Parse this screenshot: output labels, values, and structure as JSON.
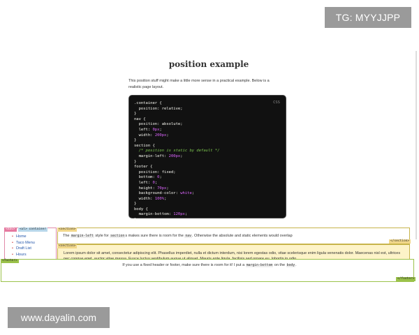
{
  "watermarks": {
    "top": "TG: MYYJJPP",
    "bottom": "www.dayalin.com"
  },
  "article": {
    "title": "position example",
    "intro": "This position stuff might make a little more sense in a practical example. Below is a realistic page layout."
  },
  "code_block": {
    "language_label": "CSS",
    "lines": [
      [
        {
          "t": ".container {"
        }
      ],
      [
        {
          "t": "  position: relative;"
        }
      ],
      [
        {
          "t": "}"
        }
      ],
      [
        {
          "t": "nav {"
        }
      ],
      [
        {
          "t": "  position: absolute;"
        }
      ],
      [
        {
          "t": "  left: "
        },
        {
          "t": "0px",
          "k": "v"
        },
        {
          "t": ";"
        }
      ],
      [
        {
          "t": "  width: "
        },
        {
          "t": "200px",
          "k": "v"
        },
        {
          "t": ";"
        }
      ],
      [
        {
          "t": "}"
        }
      ],
      [
        {
          "t": "section {"
        }
      ],
      [
        {
          "t": "  /* position is static by default */",
          "k": "c"
        }
      ],
      [
        {
          "t": "  margin-left: "
        },
        {
          "t": "200px",
          "k": "v"
        },
        {
          "t": ";"
        }
      ],
      [
        {
          "t": "}"
        }
      ],
      [
        {
          "t": "footer {"
        }
      ],
      [
        {
          "t": "  position: fixed;"
        }
      ],
      [
        {
          "t": "  bottom: "
        },
        {
          "t": "0",
          "k": "v"
        },
        {
          "t": ";"
        }
      ],
      [
        {
          "t": "  left: "
        },
        {
          "t": "0",
          "k": "v"
        },
        {
          "t": ";"
        }
      ],
      [
        {
          "t": "  height: "
        },
        {
          "t": "70px",
          "k": "v"
        },
        {
          "t": ";"
        }
      ],
      [
        {
          "t": "  background-color: "
        },
        {
          "t": "white",
          "k": "v"
        },
        {
          "t": ";"
        }
      ],
      [
        {
          "t": "  width: "
        },
        {
          "t": "100%",
          "k": "v"
        },
        {
          "t": ";"
        }
      ],
      [
        {
          "t": "}"
        }
      ],
      [
        {
          "t": "body {"
        }
      ],
      [
        {
          "t": "  margin-bottom: "
        },
        {
          "t": "120px",
          "k": "v"
        },
        {
          "t": ";"
        }
      ],
      [
        {
          "t": "}"
        }
      ]
    ]
  },
  "demo": {
    "nav_tag": "<nav>",
    "ul_tag": "<ul> container",
    "nav_items": [
      "Home",
      "Taco Menu",
      "Draft List",
      "Hours"
    ],
    "section_tag_open": "<section>",
    "section_tag_close": "</section>",
    "section1": {
      "before": "The ",
      "code1": "margin-left",
      "middle": " style for ",
      "code2": "section",
      "middle2": "s makes sure there is room for the ",
      "code3": "nav",
      "after": ". Otherwise the absolute and static elements would overlap"
    },
    "section2_text": "Lorem ipsum dolor sit amet, consectetur adipiscing elit. Phasellus imperdiet, nulla et dictum interdum, nisi lorem egestas odio, vitae scelerisque enim ligula venenatis dolor. Maecenas nisl est, ultrices nec congue eget, auctor vitae massa. Fusce luctus vestibulum augue ut aliquet. Mauris ante ligula, facilisis sed ornare eu, lobortis in odio.",
    "footer_tag_open": "<footer>",
    "footer_tag_close": "</footer>",
    "footer": {
      "before": "If you use a fixed header or footer, make sure there is room for it! I put a ",
      "code": "margin-bottom",
      "middle": " on the ",
      "code2": "body",
      "after": "."
    }
  }
}
